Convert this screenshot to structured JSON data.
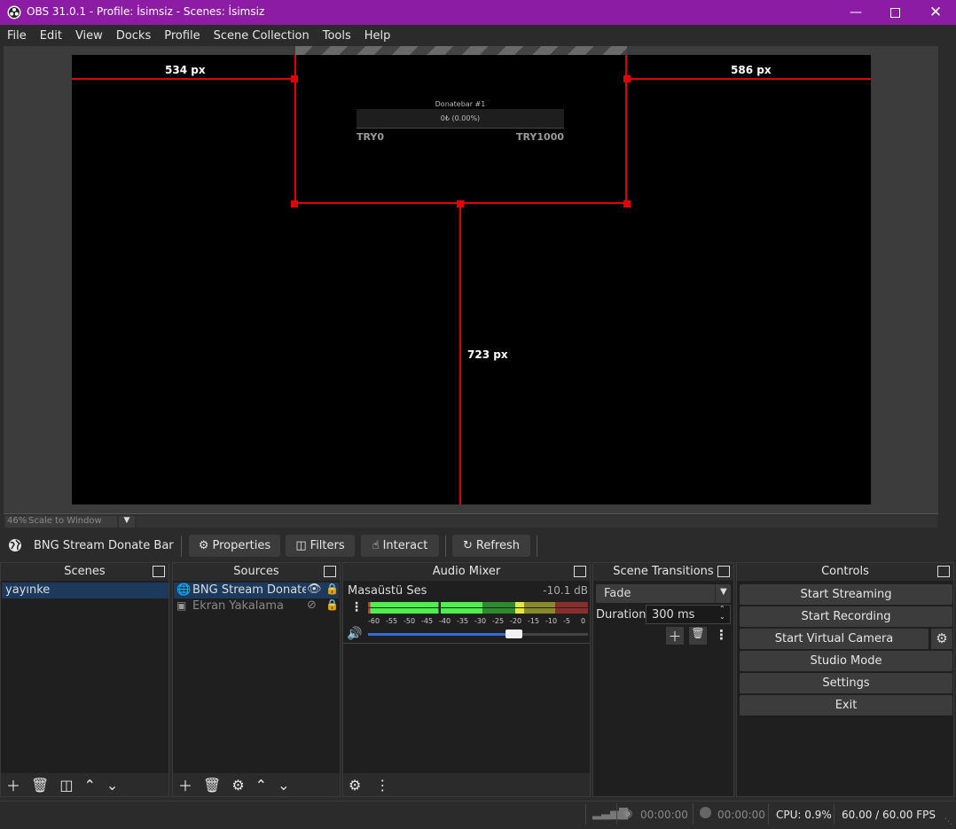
{
  "window": {
    "title": "OBS 31.0.1 - Profile: İsimsiz - Scenes: İsimsiz"
  },
  "menu": [
    "File",
    "Edit",
    "View",
    "Docks",
    "Profile",
    "Scene Collection",
    "Tools",
    "Help"
  ],
  "preview": {
    "dim_left": "534 px",
    "dim_right": "586 px",
    "dim_bottom": "723 px",
    "donate_title": "Donatebar #1",
    "donate_progress": "0₺ (0.00%)",
    "donate_min": "TRY0",
    "donate_max": "TRY1000",
    "progress": 0
  },
  "scale": {
    "percent": "46%",
    "mode": "Scale to Window"
  },
  "source_toolbar": {
    "selected": "BNG Stream Donate Bar",
    "properties": "Properties",
    "filters": "Filters",
    "interact": "Interact",
    "refresh": "Refresh"
  },
  "docks": {
    "scenes": "Scenes",
    "sources": "Sources",
    "mixer": "Audio Mixer",
    "transitions": "Scene Transitions",
    "controls": "Controls"
  },
  "scenes": [
    "yayınke"
  ],
  "sources": [
    {
      "name": "BNG Stream Donate Bar",
      "visible": true
    },
    {
      "name": "Ekran Yakalama",
      "visible": false
    }
  ],
  "mixer": {
    "channel": "Masaüstü Ses",
    "db": "-10.1 dB",
    "ticks": [
      "-60",
      "-55",
      "-50",
      "-45",
      "-40",
      "-35",
      "-30",
      "-25",
      "-20",
      "-15",
      "-10",
      "-5",
      "0"
    ],
    "volume": 0.66
  },
  "transitions": {
    "type": "Fade",
    "duration_label": "Duration",
    "duration": "300 ms"
  },
  "controls": [
    "Start Streaming",
    "Start Recording",
    "Start Virtual Camera",
    "Studio Mode",
    "Settings",
    "Exit"
  ],
  "status": {
    "stream_time": "00:00:00",
    "rec_time": "00:00:00",
    "cpu": "CPU: 0.9%",
    "fps": "60.00 / 60.00 FPS"
  },
  "colors": {
    "titlebar": "#8c1ca3",
    "guide": "#e00000",
    "selection": "#1d3a5c"
  }
}
